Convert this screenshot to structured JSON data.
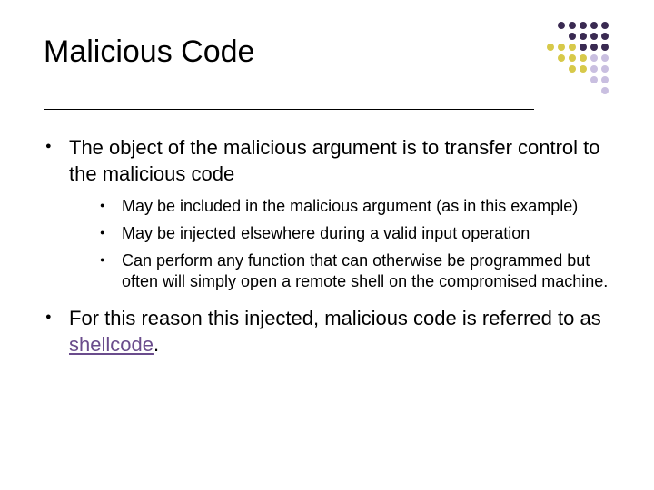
{
  "title": "Malicious Code",
  "bullets": [
    {
      "text": "The object of the malicious argument is to transfer control to the malicious code",
      "sub": [
        "May be included in the malicious argument (as in this example)",
        "May be injected elsewhere during a valid input operation",
        "Can perform any function that can otherwise be programmed but often will simply open a remote shell on the compromised machine."
      ]
    },
    {
      "text_pre": "For this reason this injected, malicious code is referred to as ",
      "term": "shellcode",
      "text_post": "."
    }
  ],
  "deco_colors": {
    "dark": "#3a2a52",
    "yellow": "#d7c94a",
    "light": "#c9bfe0"
  }
}
